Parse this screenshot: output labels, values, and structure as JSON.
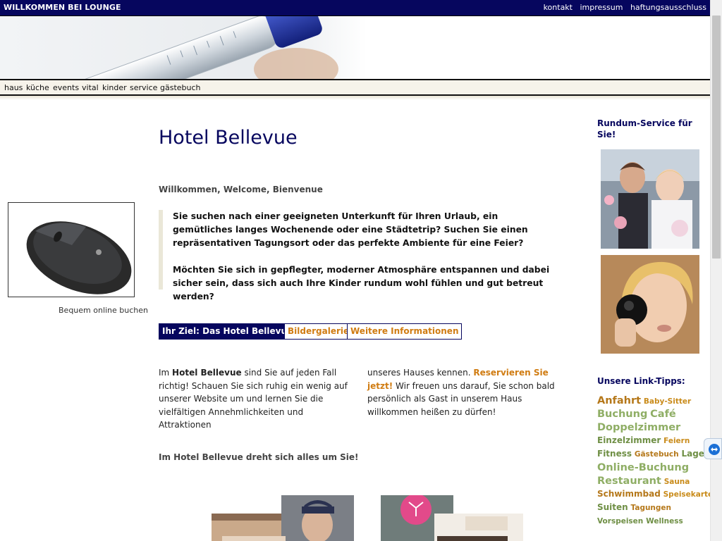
{
  "header": {
    "site_name": "WILLKOMMEN BEI LOUNGE",
    "top_links": [
      "kontakt",
      "impressum",
      "haftungsausschluss"
    ]
  },
  "nav": {
    "items": [
      "haus",
      "küche",
      "events",
      "vital",
      "kinder",
      "service",
      "gästebuch"
    ]
  },
  "left": {
    "caption": "Bequem online buchen"
  },
  "main": {
    "title": "Hotel Bellevue",
    "welcome": "Willkommen, Welcome, Bienvenue",
    "quote_p1": "Sie suchen nach einer geeigneten Unterkunft für Ihren Urlaub, ein gemütliches langes Wochenende oder eine Städtetrip? Suchen Sie einen repräsentativen Tagungsort oder das perfekte Ambiente für eine Feier?",
    "quote_p2": "Möchten Sie sich in gepflegter, moderner Atmosphäre entspannen und dabei sicher sein, dass sich auch Ihre Kinder rundum wohl fühlen und gut betreut werden?",
    "tabs": [
      "Ihr Ziel: Das Hotel Bellevue",
      "Bildergalerie",
      "Weitere Informationen"
    ],
    "col1_a": "Im ",
    "col1_b": "Hotel Bellevue",
    "col1_c": " sind Sie auf jeden Fall richtig! Schauen Sie sich ruhig ein wenig auf unserer Website um und lernen Sie die vielfältigen Annehmlichkeiten und Attraktionen",
    "col2_a": "unseres Hauses kennen. ",
    "col2_link": "Reservieren Sie jetzt!",
    "col2_b": " Wir freuen uns darauf, Sie schon bald persönlich als Gast in unserem Haus willkommen heißen zu dürfen!",
    "slogan": "Im Hotel Bellevue dreht sich alles um Sie!"
  },
  "sidebar": {
    "heading": "Rundum-Service für Sie!",
    "tips_heading": "Unsere Link-Tipps:",
    "tags": [
      "Anfahrt",
      "Baby-Sitter",
      "Buchung",
      "Café",
      "Doppelzimmer",
      "Einzelzimmer",
      "Feiern",
      "Fitness",
      "Gästebuch",
      "Lage",
      "Online-Buchung",
      "Restaurant",
      "Sauna",
      "Schwimmbad",
      "Speisekarte",
      "Suiten",
      "Tagungen",
      "Vorspeisen",
      "Wellness"
    ]
  },
  "colors": {
    "navy": "#06065e",
    "orange": "#d07c12",
    "tag_green": "#8fae65",
    "tag_orange": "#c98b1a"
  }
}
